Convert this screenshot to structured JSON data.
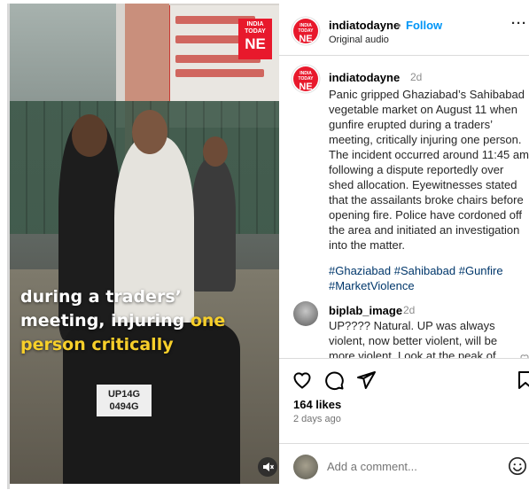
{
  "video": {
    "logo_top": "INDIA TODAY",
    "logo_big": "NE",
    "caption_line1": "during a traders’",
    "caption_line2_a": "meeting, injuring ",
    "caption_line2_hl": "one",
    "caption_line3_hl": "person critically",
    "plate_line1": "UP14G",
    "plate_line2": "0494G",
    "mute_icon": "speaker-muted-icon"
  },
  "header": {
    "username": "indiatodayne",
    "separator": "•",
    "follow_label": "Follow",
    "audio_label": "Original audio",
    "more_label": "···"
  },
  "caption": {
    "author": "indiatodayne",
    "time": "2d",
    "text": "Panic gripped Ghaziabad’s Sahibabad vegetable market on August 11 when gunfire erupted during a traders’ meeting, critically injuring one person. The incident occurred around 11:45 am following a dispute reportedly over shed allocation. Eyewitnesses stated that the assailants broke chairs before opening fire. Police have cordoned off the area and initiated an investigation into the matter.",
    "hashtags": "#Ghaziabad #Sahibabad #Gunfire #MarketViolence"
  },
  "comment": {
    "author": "biplab_image",
    "time": "2d",
    "text": "UP???? Natural. UP was always violent, now better violent, will be more violent. Look at the peak of"
  },
  "actions": {
    "likes": "164 likes",
    "ago": "2 days ago"
  },
  "add_comment": {
    "placeholder": "Add a comment..."
  },
  "colors": {
    "brand_red": "#e8192c",
    "link_blue": "#0095f6",
    "hashtag": "#00376b",
    "caption_highlight": "#f7cf2a"
  }
}
